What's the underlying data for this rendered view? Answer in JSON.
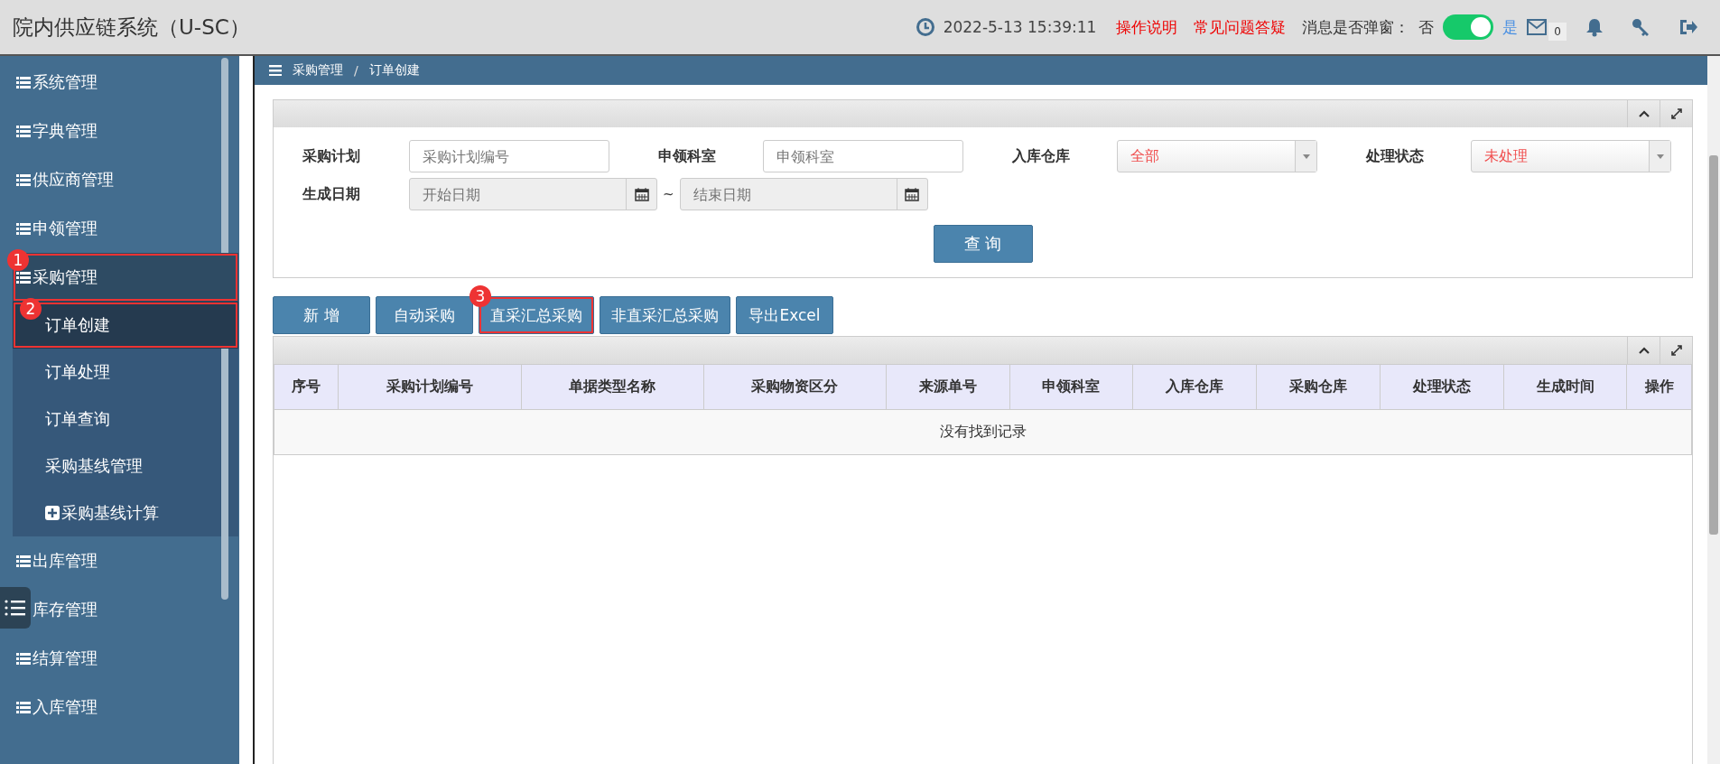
{
  "header": {
    "title": "院内供应链系统（U-SC）",
    "datetime": "2022-5-13  15:39:11",
    "links": [
      "操作说明",
      "常见问题答疑"
    ],
    "popup_label": "消息是否弹窗：",
    "toggle": {
      "off_label": "否",
      "on_label": "是",
      "on": true
    },
    "mail_count": "0"
  },
  "sidebar": {
    "items": [
      {
        "label": "系统管理",
        "expanded": false
      },
      {
        "label": "字典管理",
        "expanded": false
      },
      {
        "label": "供应商管理",
        "expanded": false
      },
      {
        "label": "申领管理",
        "expanded": false
      },
      {
        "label": "采购管理",
        "expanded": true,
        "annotation": "1",
        "children": [
          {
            "label": "订单创建",
            "selected": true,
            "annotation": "2"
          },
          {
            "label": "订单处理",
            "selected": false
          },
          {
            "label": "订单查询",
            "selected": false
          },
          {
            "label": "采购基线管理",
            "selected": false
          },
          {
            "label": "采购基线计算",
            "selected": false,
            "has_children": true
          }
        ]
      },
      {
        "label": "出库管理",
        "expanded": false
      },
      {
        "label": "库存管理",
        "expanded": false,
        "icon_hidden": true
      },
      {
        "label": "结算管理",
        "expanded": false
      },
      {
        "label": "入库管理",
        "expanded": false
      }
    ]
  },
  "breadcrumb": [
    "采购管理",
    "订单创建"
  ],
  "breadcrumb_separator": "/",
  "filters": [
    {
      "label": "采购计划",
      "kind": "text",
      "placeholder": "采购计划编号"
    },
    {
      "label": "申领科室",
      "kind": "text",
      "placeholder": "申领科室"
    },
    {
      "label": "入库仓库",
      "kind": "select",
      "value": "全部"
    },
    {
      "label": "处理状态",
      "kind": "select",
      "value": "未处理"
    },
    {
      "label": "生成日期",
      "kind": "daterange",
      "placeholder": "开始日期",
      "separator": "~",
      "placeholder_end": "结束日期"
    }
  ],
  "query_button": "查 询",
  "toolbar": [
    {
      "label": "新 增"
    },
    {
      "label": "自动采购"
    },
    {
      "label": "直采汇总采购",
      "annotation": "3"
    },
    {
      "label": "非直采汇总采购"
    },
    {
      "label": "导出Excel"
    }
  ],
  "table": {
    "columns": [
      "序号",
      "采购计划编号",
      "单据类型名称",
      "采购物资区分",
      "来源单号",
      "申领科室",
      "入库仓库",
      "采购仓库",
      "处理状态",
      "生成时间",
      "操作"
    ],
    "empty_message": "没有找到记录"
  }
}
